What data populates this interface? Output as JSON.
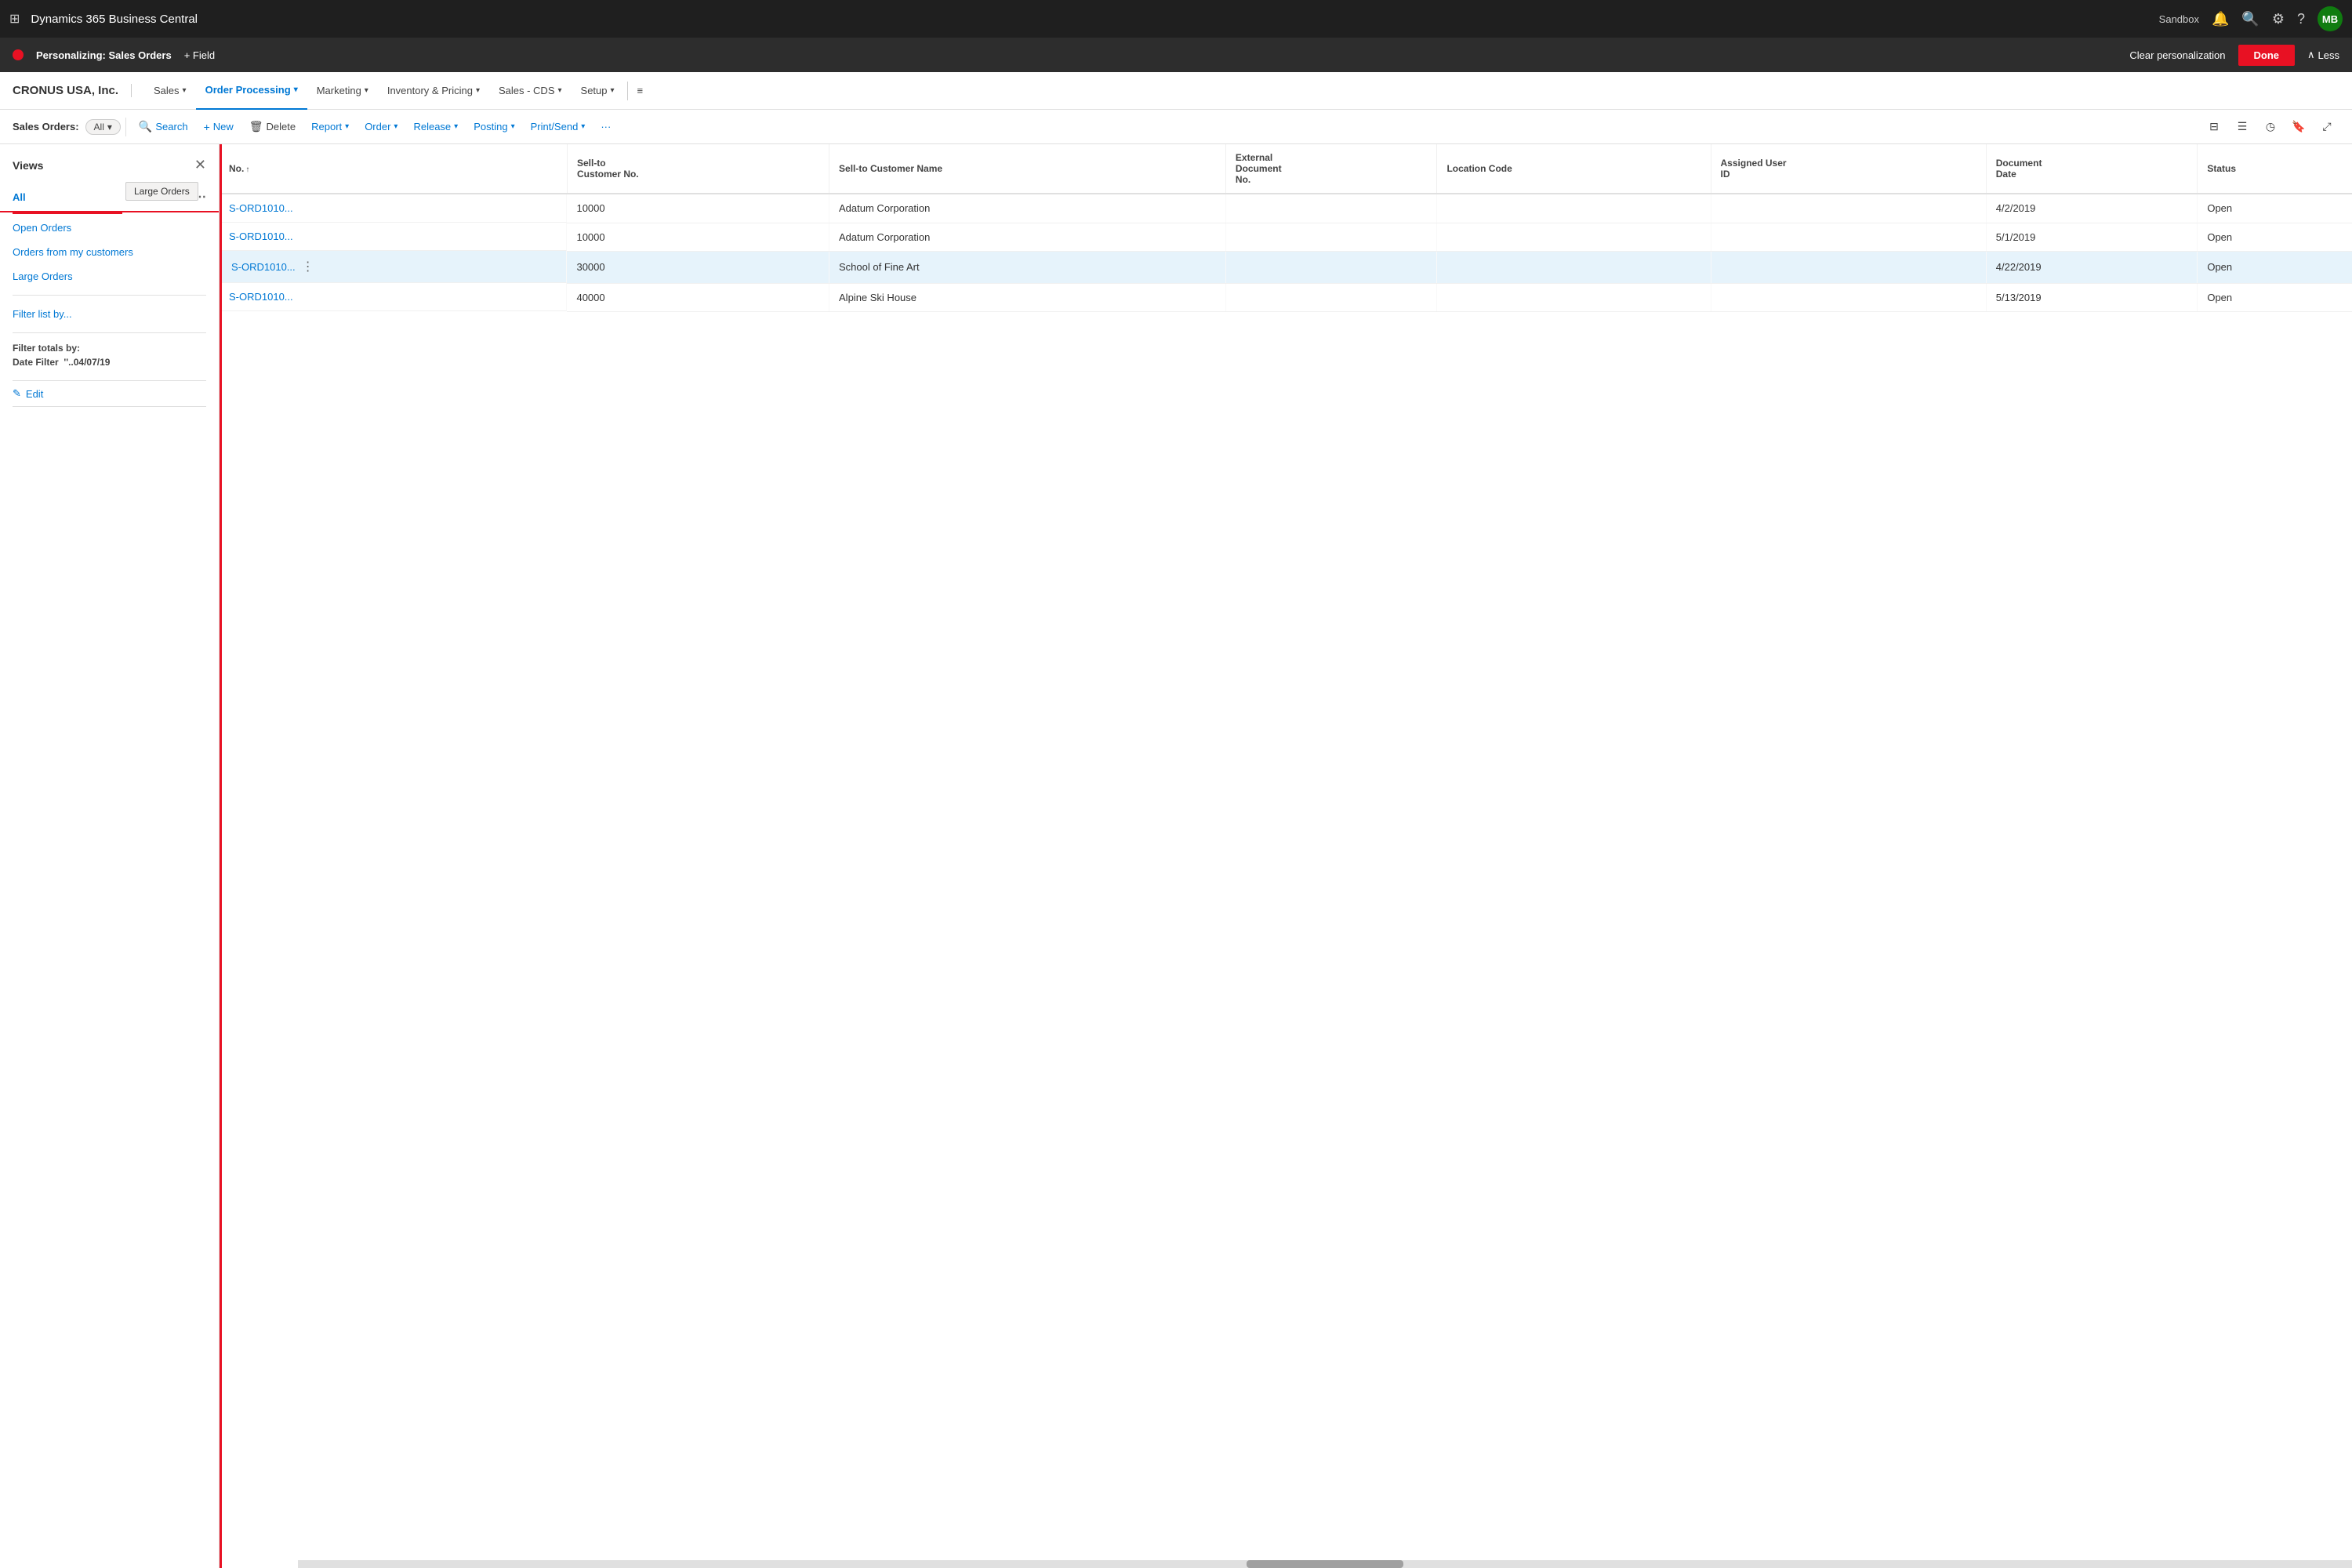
{
  "app": {
    "title": "Dynamics 365 Business Central",
    "environment": "Sandbox",
    "avatar_initials": "MB"
  },
  "personalize_bar": {
    "label": "Personalizing:",
    "page_name": "Sales Orders",
    "field_btn": "+ Field",
    "clear_btn": "Clear personalization",
    "done_btn": "Done",
    "less_btn": "Less"
  },
  "company_nav": {
    "company_name": "CRONUS USA, Inc.",
    "items": [
      {
        "label": "Sales",
        "active": false
      },
      {
        "label": "Order Processing",
        "active": true
      },
      {
        "label": "Marketing",
        "active": false
      },
      {
        "label": "Inventory & Pricing",
        "active": false
      },
      {
        "label": "Sales - CDS",
        "active": false
      },
      {
        "label": "Setup",
        "active": false
      }
    ]
  },
  "action_bar": {
    "page_label": "Sales Orders:",
    "filter_value": "All",
    "search_btn": "Search",
    "new_btn": "New",
    "delete_btn": "Delete",
    "report_btn": "Report",
    "order_btn": "Order",
    "release_btn": "Release",
    "posting_btn": "Posting",
    "print_send_btn": "Print/Send",
    "more_btn": "···"
  },
  "views": {
    "title": "Views",
    "items": [
      {
        "label": "All",
        "active": true
      },
      {
        "label": "Open Orders",
        "active": false
      },
      {
        "label": "Orders from my customers",
        "active": false
      },
      {
        "label": "Large Orders",
        "active": false
      }
    ],
    "drag_tooltip": "Large Orders",
    "filter_list_by": "Filter list by...",
    "filter_totals_label": "Filter totals by:",
    "date_filter_label": "Date Filter",
    "date_filter_value": "''..04/07/19",
    "edit_btn": "Edit"
  },
  "table": {
    "columns": [
      {
        "label": "No.",
        "sort": "asc"
      },
      {
        "label": "Sell-to Customer No."
      },
      {
        "label": "Sell-to Customer Name"
      },
      {
        "label": "External Document No."
      },
      {
        "label": "Location Code"
      },
      {
        "label": "Assigned User ID"
      },
      {
        "label": "Document Date"
      },
      {
        "label": "Status"
      }
    ],
    "rows": [
      {
        "no": "S-ORD1010...",
        "customer_no": "10000",
        "customer_name": "Adatum Corporation",
        "ext_doc": "",
        "location": "",
        "assigned_user": "",
        "doc_date": "4/2/2019",
        "status": "Open",
        "selected": false
      },
      {
        "no": "S-ORD1010...",
        "customer_no": "10000",
        "customer_name": "Adatum Corporation",
        "ext_doc": "",
        "location": "",
        "assigned_user": "",
        "doc_date": "5/1/2019",
        "status": "Open",
        "selected": false
      },
      {
        "no": "S-ORD1010...",
        "customer_no": "30000",
        "customer_name": "School of Fine Art",
        "ext_doc": "",
        "location": "",
        "assigned_user": "",
        "doc_date": "4/22/2019",
        "status": "Open",
        "selected": true
      },
      {
        "no": "S-ORD1010...",
        "customer_no": "40000",
        "customer_name": "Alpine Ski House",
        "ext_doc": "",
        "location": "",
        "assigned_user": "",
        "doc_date": "5/13/2019",
        "status": "Open",
        "selected": false
      }
    ]
  }
}
